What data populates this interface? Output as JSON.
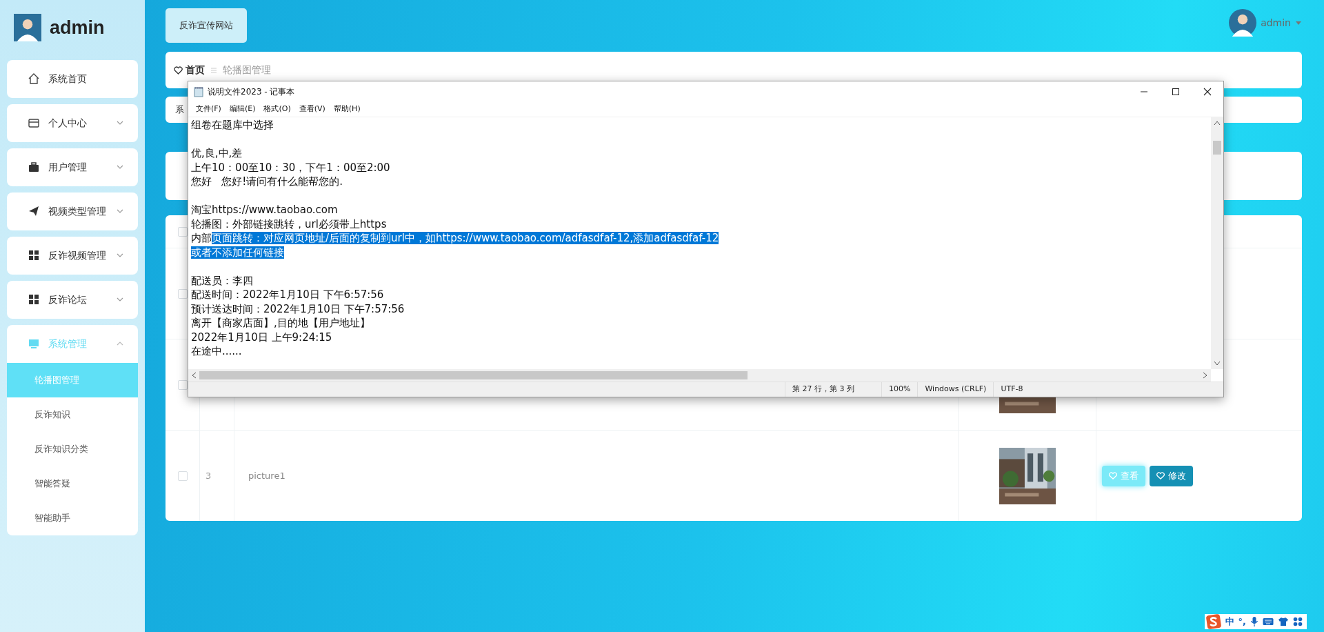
{
  "sidebar": {
    "user": {
      "name": "admin"
    },
    "items": [
      {
        "label": "系统首页",
        "kind": "link",
        "selected": false
      },
      {
        "label": "个人中心",
        "kind": "group",
        "selected": false,
        "expanded": false
      },
      {
        "label": "用户管理",
        "kind": "group",
        "selected": false,
        "expanded": false
      },
      {
        "label": "视频类型管理",
        "kind": "group",
        "selected": false,
        "expanded": false
      },
      {
        "label": "反诈视频管理",
        "kind": "group",
        "selected": false,
        "expanded": false
      },
      {
        "label": "反诈论坛",
        "kind": "group",
        "selected": false,
        "expanded": false
      },
      {
        "label": "系统管理",
        "kind": "group",
        "selected": true,
        "expanded": true,
        "children": [
          {
            "label": "轮播图管理",
            "selected": true
          },
          {
            "label": "反诈知识",
            "selected": false
          },
          {
            "label": "反诈知识分类",
            "selected": false
          },
          {
            "label": "智能答疑",
            "selected": false
          },
          {
            "label": "智能助手",
            "selected": false
          }
        ]
      }
    ]
  },
  "top_button": "反诈宣传网站",
  "user_menu": {
    "name": "admin"
  },
  "breadcrumb": [
    "首页",
    "轮播图管理"
  ],
  "search_card": {
    "text": "系"
  },
  "table": {
    "header_checked": false,
    "rows": [
      {
        "checked": false
      },
      {
        "checked": false,
        "image": {
          "kind": "picture"
        }
      },
      {
        "checked": false,
        "index": "3",
        "name": "picture1",
        "image": {
          "kind": "picture"
        },
        "actions": [
          {
            "label": "查看",
            "hover": true
          },
          {
            "label": "修改",
            "hover": false
          }
        ]
      }
    ]
  },
  "notepad": {
    "title": "说明文件2023 - 记事本",
    "menu": [
      "文件(F)",
      "编辑(E)",
      "格式(O)",
      "查看(V)",
      "帮助(H)"
    ],
    "lines": [
      {
        "kind": "text",
        "segments": [
          {
            "text": "组卷在题库中选择",
            "selected": false
          }
        ]
      },
      {
        "kind": "blank"
      },
      {
        "kind": "text",
        "segments": [
          {
            "text": "优,良,中,差",
            "selected": false
          }
        ]
      },
      {
        "kind": "text",
        "segments": [
          {
            "text": "上午10：00至10：30，下午1：00至2:00",
            "selected": false
          }
        ]
      },
      {
        "kind": "text",
        "segments": [
          {
            "text": "您好   您好!请问有什么能帮您的.",
            "selected": false
          }
        ]
      },
      {
        "kind": "blank"
      },
      {
        "kind": "text",
        "segments": [
          {
            "text": "淘宝https://www.taobao.com",
            "selected": false
          }
        ]
      },
      {
        "kind": "text",
        "segments": [
          {
            "text": "轮播图：外部链接跳转，url必须带上https",
            "selected": false
          }
        ]
      },
      {
        "kind": "text",
        "segments": [
          {
            "text": "内部",
            "selected": false
          },
          {
            "text": "页面跳转：对应网页地址/后面的复制到url中，如https://www.taobao.com/adfasdfaf-12,添加adfasdfaf-12",
            "selected": true
          }
        ]
      },
      {
        "kind": "text",
        "segments": [
          {
            "text": "或者不添加任何链接",
            "selected": true
          }
        ]
      },
      {
        "kind": "blank"
      },
      {
        "kind": "text",
        "segments": [
          {
            "text": "配送员：李四",
            "selected": false
          }
        ]
      },
      {
        "kind": "text",
        "segments": [
          {
            "text": "配送时间：2022年1月10日 下午6:57:56",
            "selected": false
          }
        ]
      },
      {
        "kind": "text",
        "segments": [
          {
            "text": "预计送达时间：2022年1月10日 下午7:57:56",
            "selected": false
          }
        ]
      },
      {
        "kind": "text",
        "segments": [
          {
            "text": "离开【商家店面】,目的地【用户地址】",
            "selected": false
          }
        ]
      },
      {
        "kind": "text",
        "segments": [
          {
            "text": "2022年1月10日 上午9:24:15",
            "selected": false
          }
        ]
      },
      {
        "kind": "text",
        "segments": [
          {
            "text": "在途中......",
            "selected": false
          }
        ]
      }
    ],
    "status": [
      "第 27 行，第 3 列",
      "100%",
      "Windows (CRLF)",
      "UTF-8"
    ]
  },
  "ime": {
    "items": [
      "中",
      "°,"
    ]
  }
}
